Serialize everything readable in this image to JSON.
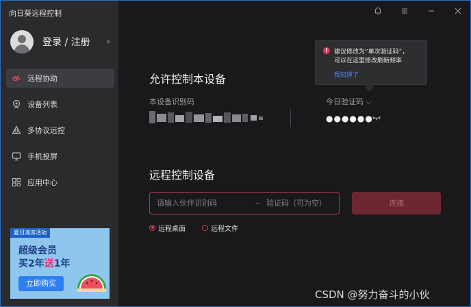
{
  "app": {
    "title": "向日葵远程控制"
  },
  "sidebar": {
    "login_label": "登录 / 注册",
    "items": [
      {
        "label": "远程协助",
        "icon": "remote-assist-icon",
        "active": true
      },
      {
        "label": "设备列表",
        "icon": "device-list-icon",
        "active": false
      },
      {
        "label": "多协议远控",
        "icon": "multi-protocol-icon",
        "active": false
      },
      {
        "label": "手机投屏",
        "icon": "screen-cast-icon",
        "active": false
      },
      {
        "label": "应用中心",
        "icon": "app-center-icon",
        "active": false
      }
    ],
    "banner": {
      "tag": "夏日清凉活动",
      "line1": "超级会员",
      "line2_pre": "买2年",
      "line2_hl": "送",
      "line2_post": "1年",
      "button": "立即购买"
    }
  },
  "main": {
    "allow": {
      "title": "允许控制本设备",
      "device_code_label": "本设备识别码",
      "today_code_label": "今日验证码",
      "today_code_value": "●●●●●●"
    },
    "tooltip": {
      "line1": "建议修改为“单次验证码”，",
      "line2": "可以在这里修改刷新频率",
      "ok": "我知道了"
    },
    "control": {
      "title": "远程控制设备",
      "partner_placeholder": "请输入伙伴识别码",
      "code_placeholder": "验证码（可为空）",
      "connect_label": "连接",
      "options": [
        {
          "label": "远程桌面",
          "selected": true
        },
        {
          "label": "远程文件",
          "selected": false
        }
      ]
    }
  },
  "watermark": "CSDN @努力奋斗的小伙",
  "colors": {
    "accent": "#d2465a",
    "link": "#3d8bff",
    "sidebar": "#2b2b2e",
    "main": "#19191b"
  }
}
